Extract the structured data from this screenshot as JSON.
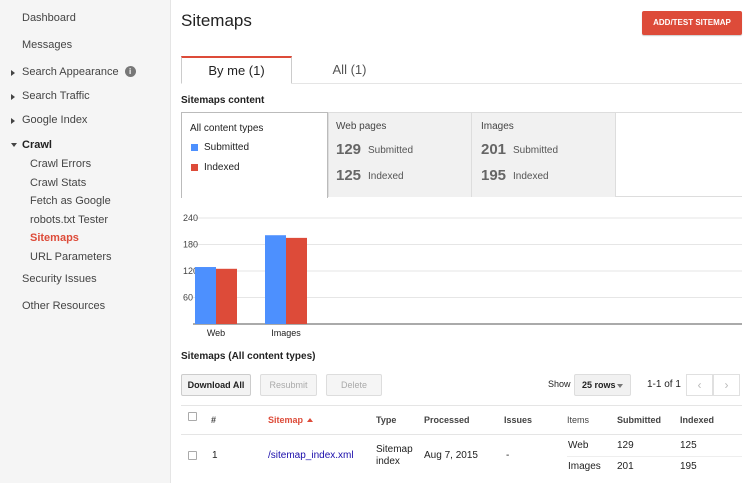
{
  "sidebar": {
    "items": [
      {
        "label": "Dashboard"
      },
      {
        "label": "Messages"
      },
      {
        "label": "Search Appearance",
        "info_icon": "i"
      },
      {
        "label": "Search Traffic"
      },
      {
        "label": "Google Index"
      },
      {
        "label": "Crawl"
      },
      {
        "label": "Crawl Errors"
      },
      {
        "label": "Crawl Stats"
      },
      {
        "label": "Fetch as Google"
      },
      {
        "label": "robots.txt Tester"
      },
      {
        "label": "Sitemaps"
      },
      {
        "label": "URL Parameters"
      },
      {
        "label": "Security Issues"
      },
      {
        "label": "Other Resources"
      }
    ]
  },
  "header": {
    "title": "Sitemaps",
    "add_button": "ADD/TEST SITEMAP"
  },
  "tabs": [
    {
      "label": "By me (1)"
    },
    {
      "label": "All (1)"
    }
  ],
  "content": {
    "section_title": "Sitemaps content",
    "all_types": {
      "label": "All content types",
      "legend": [
        {
          "label": "Submitted",
          "color": "#4d90fe"
        },
        {
          "label": "Indexed",
          "color": "#dd4b39"
        }
      ]
    },
    "groups": [
      {
        "label": "Web pages",
        "submitted": "129",
        "submitted_label": "Submitted",
        "indexed": "125",
        "indexed_label": "Indexed"
      },
      {
        "label": "Images",
        "submitted": "201",
        "submitted_label": "Submitted",
        "indexed": "195",
        "indexed_label": "Indexed"
      }
    ]
  },
  "chart_data": {
    "type": "bar",
    "categories": [
      "Web",
      "Images"
    ],
    "series": [
      {
        "name": "Submitted",
        "values": [
          129,
          201
        ],
        "color": "#4d90fe"
      },
      {
        "name": "Indexed",
        "values": [
          125,
          195
        ],
        "color": "#dd4b39"
      }
    ],
    "yticks": [
      "60",
      "120",
      "180",
      "240"
    ],
    "ylim": [
      0,
      240
    ],
    "grid": true
  },
  "table": {
    "section_title": "Sitemaps (All content types)",
    "buttons": {
      "download": "Download All",
      "resubmit": "Resubmit",
      "delete": "Delete"
    },
    "show_label": "Show",
    "rows_value": "25 rows",
    "range": "1-1 of 1",
    "pager": {
      "prev": "‹",
      "next": "›"
    },
    "headers": {
      "num": "#",
      "sitemap": "Sitemap",
      "type": "Type",
      "processed": "Processed",
      "issues": "Issues",
      "items": "Items",
      "submitted": "Submitted",
      "indexed": "Indexed"
    },
    "rows": [
      {
        "num": "1",
        "sitemap": "/sitemap_index.xml",
        "type_line1": "Sitemap",
        "type_line2": "index",
        "processed": "Aug 7, 2015",
        "issues": "-",
        "items": [
          {
            "item": "Web",
            "submitted": "129",
            "indexed": "125"
          },
          {
            "item": "Images",
            "submitted": "201",
            "indexed": "195"
          }
        ]
      }
    ]
  }
}
